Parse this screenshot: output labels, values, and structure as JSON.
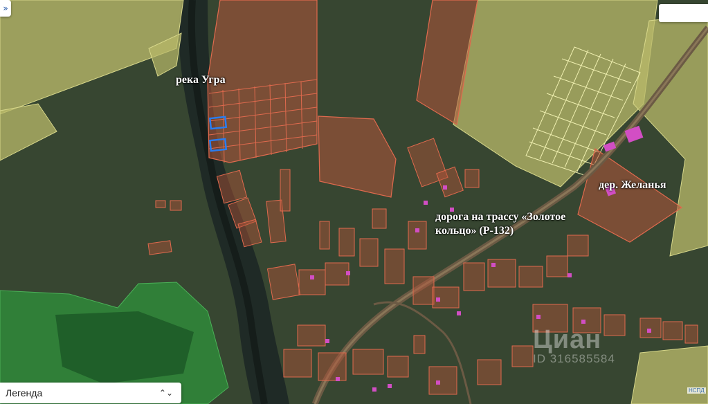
{
  "labels": {
    "river": "река Угра",
    "road": "дорога на трассу «Золотое кольцо» (Р-132)",
    "village": "дер. Желанья"
  },
  "controls": {
    "top_left_button": "»",
    "legend_label": "Легенда",
    "legend_chevron": "⌃⌄"
  },
  "watermark": {
    "brand": "Циан",
    "listing_id": "ID 316585584"
  },
  "corner_tag": "НСПД",
  "colors": {
    "satellite_base": "#2f3a32",
    "river": "#1f2825",
    "farmland_parcel": "#b9b96a",
    "forest_zone": "#2f8a3a",
    "cadastral_parcel_fill": "#b5553a",
    "cadastral_parcel_stroke": "#e06a4e",
    "selected_plot_stroke": "#2a7df0",
    "building": "#d24ec4",
    "road": "#6b5a44"
  }
}
